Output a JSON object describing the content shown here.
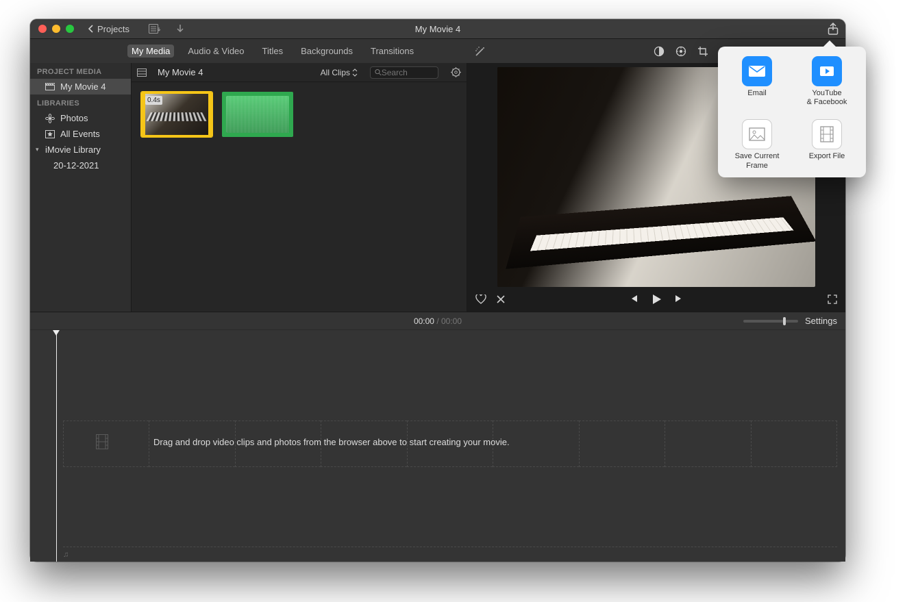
{
  "titlebar": {
    "projects_label": "Projects",
    "title": "My Movie 4"
  },
  "tabs": [
    "My Media",
    "Audio & Video",
    "Titles",
    "Backgrounds",
    "Transitions"
  ],
  "tabs_active_index": 0,
  "sidebar": {
    "section1": "PROJECT MEDIA",
    "project": "My Movie 4",
    "section2": "LIBRARIES",
    "photos": "Photos",
    "all_events": "All Events",
    "library": "iMovie Library",
    "event": "20-12-2021"
  },
  "browser": {
    "project": "My Movie 4",
    "filter": "All Clips",
    "search_placeholder": "Search",
    "clip_badge": "0.4s"
  },
  "timeline": {
    "current": "00:00",
    "total": "00:00",
    "settings": "Settings",
    "hint": "Drag and drop video clips and photos from the browser above to start creating your movie."
  },
  "share": {
    "items": [
      {
        "label": "Email",
        "icon": "email",
        "bg": "#1f8fff"
      },
      {
        "label": "YouTube\n& Facebook",
        "icon": "youtube",
        "bg": "#1f8fff"
      },
      {
        "label": "Save Current Frame",
        "icon": "frame",
        "bg": "#ffffff"
      },
      {
        "label": "Export File",
        "icon": "file",
        "bg": "#ffffff"
      }
    ]
  }
}
